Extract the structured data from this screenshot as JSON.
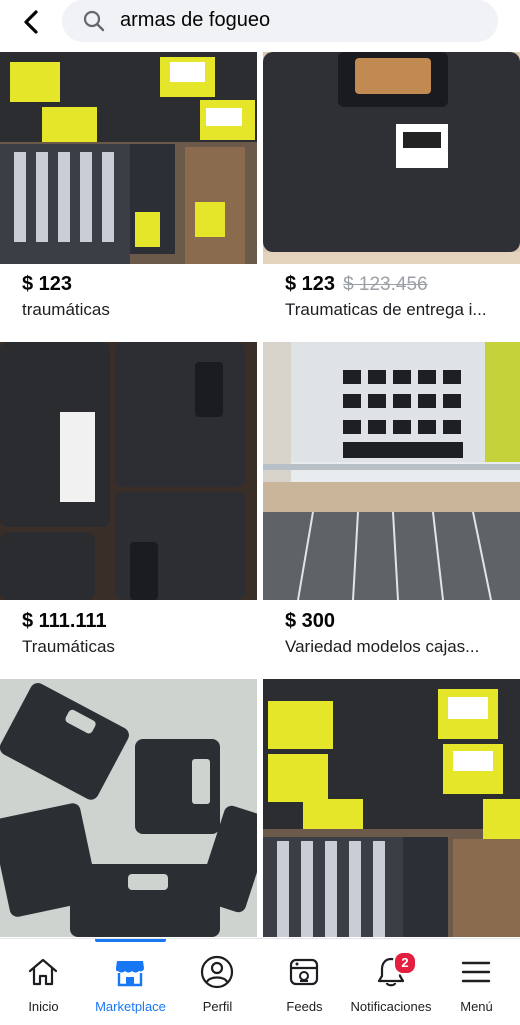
{
  "search": {
    "query": "armas de fogueo"
  },
  "listings": [
    {
      "price": "$ 123",
      "old_price": "",
      "title": "traumáticas"
    },
    {
      "price": "$ 123",
      "old_price": "$ 123.456",
      "title": "Traumaticas de entrega i..."
    },
    {
      "price": "$ 111.111",
      "old_price": "",
      "title": "Traumáticas"
    },
    {
      "price": "$ 300",
      "old_price": "",
      "title": "Variedad modelos cajas..."
    }
  ],
  "nav": {
    "items": [
      {
        "label": "Inicio",
        "icon": "home-icon"
      },
      {
        "label": "Marketplace",
        "icon": "marketplace-icon"
      },
      {
        "label": "Perfil",
        "icon": "profile-icon"
      },
      {
        "label": "Feeds",
        "icon": "feeds-icon"
      },
      {
        "label": "Notificaciones",
        "icon": "bell-icon",
        "badge": "2"
      },
      {
        "label": "Menú",
        "icon": "menu-icon"
      }
    ],
    "active_color": "#1877f2"
  }
}
